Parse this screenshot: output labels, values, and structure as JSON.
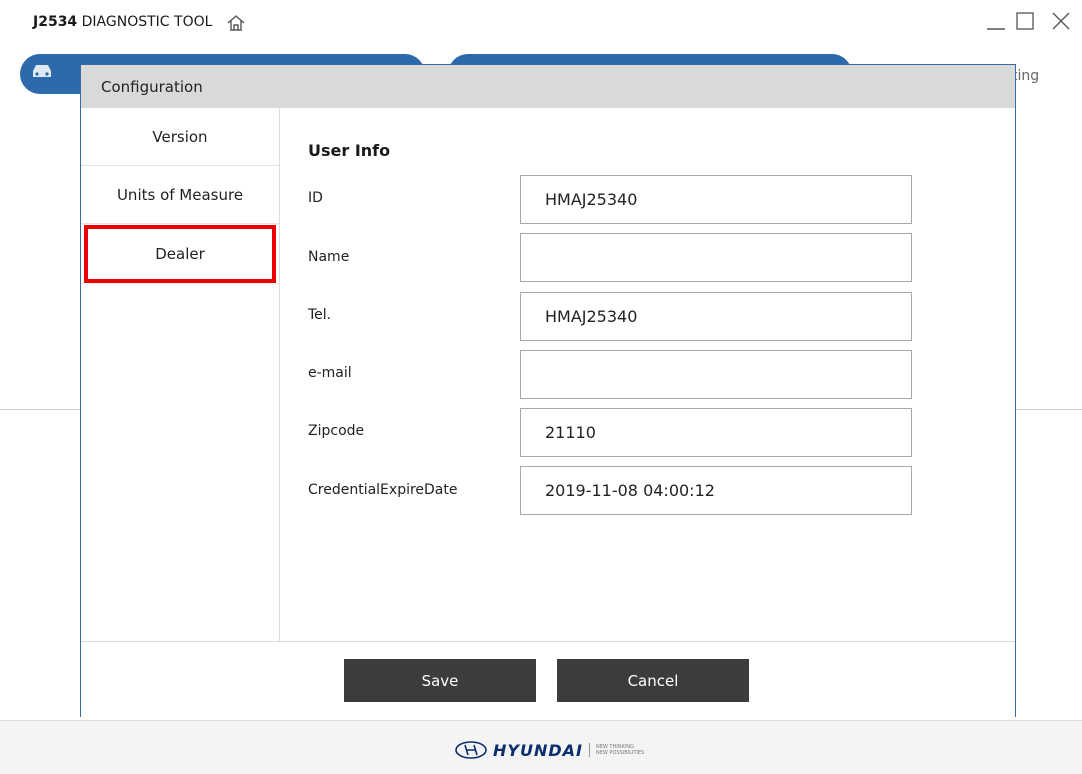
{
  "app": {
    "title_bold": "J2534",
    "title_rest": " DIAGNOSTIC TOOL"
  },
  "background": {
    "partial_tab_text": "ting"
  },
  "dialog": {
    "title": "Configuration",
    "sidebar": [
      {
        "label": "Version"
      },
      {
        "label": "Units of Measure"
      },
      {
        "label": "Dealer",
        "selected": true
      }
    ],
    "section_title": "User Info",
    "fields": [
      {
        "label": "ID",
        "value": "HMAJ25340"
      },
      {
        "label": "Name",
        "value": ""
      },
      {
        "label": "Tel.",
        "value": "HMAJ25340"
      },
      {
        "label": "e-mail",
        "value": ""
      },
      {
        "label": "Zipcode",
        "value": "21110"
      },
      {
        "label": "CredentialExpireDate",
        "value": "2019-11-08 04:00:12"
      }
    ],
    "buttons": {
      "save": "Save",
      "cancel": "Cancel"
    }
  },
  "footer": {
    "brand": "HYUNDAI",
    "slogan_line1": "NEW THINKING",
    "slogan_line2": "NEW POSSIBILITIES"
  },
  "colors": {
    "accent_blue": "#2d6aab",
    "highlight_red": "#ee0000",
    "button_dark": "#3c3c3c"
  }
}
